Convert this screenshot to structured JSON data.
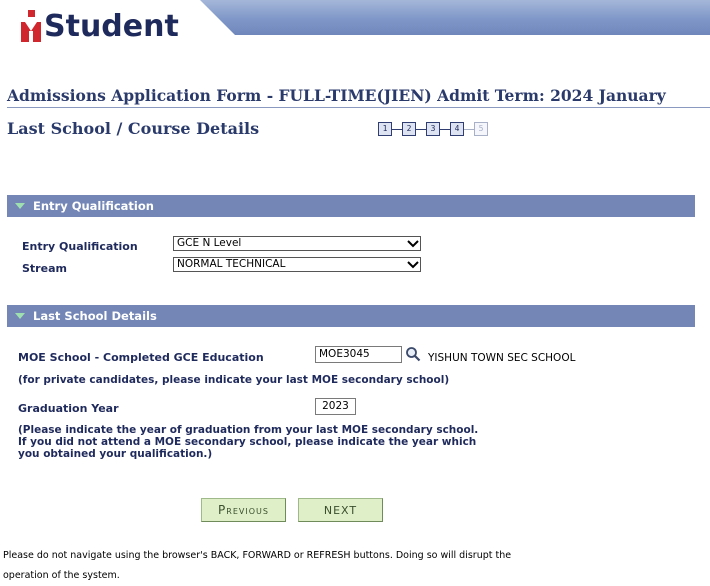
{
  "header": {
    "logo_text": "Student",
    "form_title": "Admissions Application Form - FULL-TIME(JIEN)   Admit Term: 2024 January",
    "page_title": "Last School / Course Details"
  },
  "steps": [
    {
      "label": "1",
      "active": true
    },
    {
      "label": "2",
      "active": true
    },
    {
      "label": "3",
      "active": true
    },
    {
      "label": "4",
      "active": true
    },
    {
      "label": "5",
      "active": false
    }
  ],
  "entry_qualification": {
    "section_title": "Entry Qualification",
    "qualification_label": "Entry Qualification",
    "qualification_value": "GCE N Level",
    "stream_label": "Stream",
    "stream_value": "NORMAL TECHNICAL"
  },
  "last_school": {
    "section_title": "Last School Details",
    "school_label": "MOE School - Completed GCE Education",
    "school_code": "MOE3045",
    "school_name": "YISHUN TOWN SEC SCHOOL",
    "school_note": "(for private candidates, please indicate your last MOE secondary school)",
    "grad_label": "Graduation Year",
    "grad_value": "2023",
    "grad_note_1": "(Please indicate the year of graduation from your last MOE secondary school.",
    "grad_note_2": "If you did not attend a MOE secondary school, please indicate the year which",
    "grad_note_3": "you obtained your qualification.)"
  },
  "buttons": {
    "previous": "Previous",
    "next": "NEXT"
  },
  "footer": {
    "warning_1": "Please do not navigate using the browser's BACK, FORWARD or REFRESH buttons. Doing so will disrupt the",
    "warning_2": "operation of the system."
  },
  "colors": {
    "section_bar": "#7386b6",
    "title_text": "#2a3a6b",
    "button_bg": "#dff0c8"
  }
}
